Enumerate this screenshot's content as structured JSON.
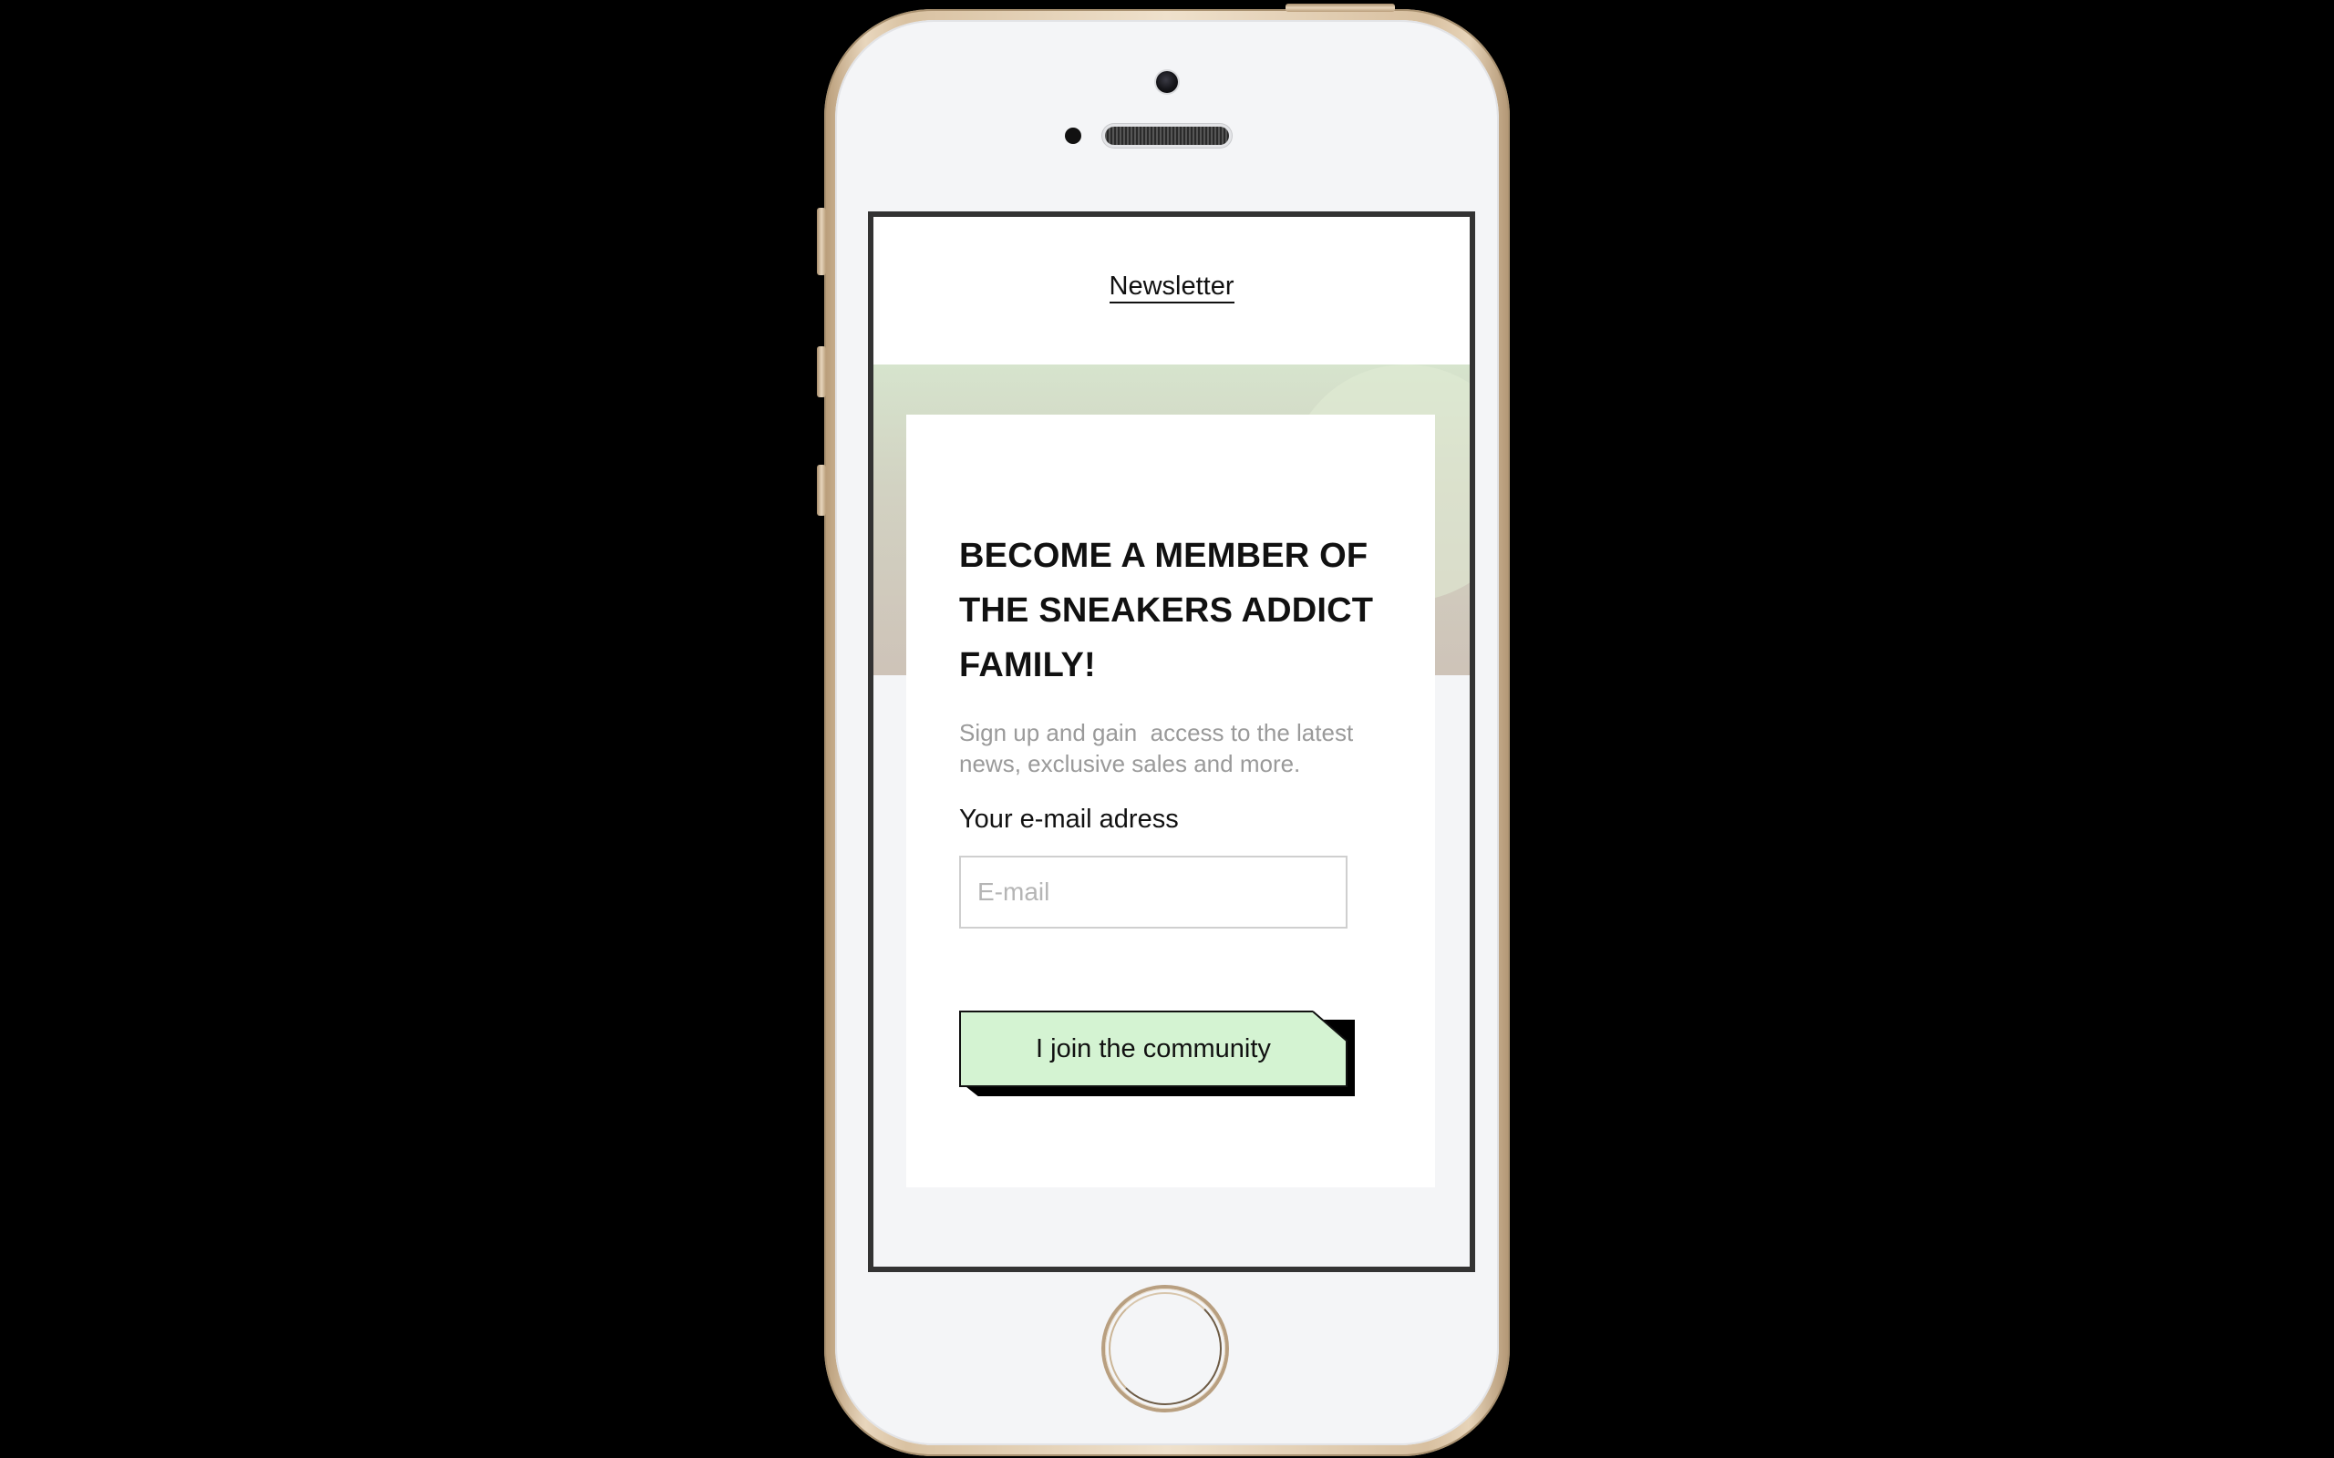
{
  "header": {
    "nav_link": "Newsletter"
  },
  "signup": {
    "title": "BECOME A MEMBER OF THE SNEAKERS ADDICT FAMILY!",
    "description": "Sign up and gain  access to the latest news, exclusive sales and more.",
    "email_label": "Your e-mail adress",
    "email_placeholder": "E-mail",
    "email_value": "",
    "submit_label": "I join the community"
  },
  "colors": {
    "page_background": "#000000",
    "cta_background": "#d4f3d2",
    "hero_gradient_top": "#d6e4cd",
    "hero_gradient_bottom": "#cec3b8",
    "phone_frame": "#e8d6bd"
  },
  "icons": {
    "home_button": "home-button-ring",
    "camera": "front-camera-dot",
    "speaker": "earpiece-speaker-grille"
  }
}
